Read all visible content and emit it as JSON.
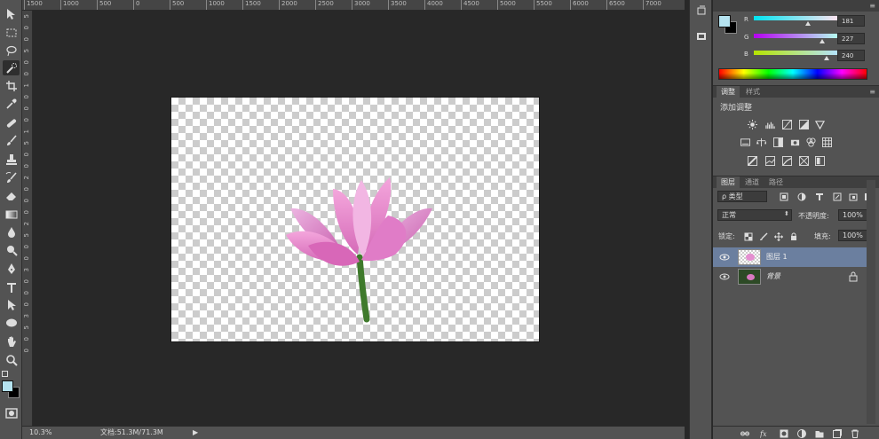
{
  "tools": [
    {
      "name": "move-tool-icon",
      "symbol": "move"
    },
    {
      "name": "rect-marquee-icon",
      "symbol": "marquee"
    },
    {
      "name": "lasso-icon",
      "symbol": "lasso"
    },
    {
      "name": "quick-select-icon",
      "symbol": "brushsel"
    },
    {
      "name": "crop-icon",
      "symbol": "crop"
    },
    {
      "name": "eyedropper-icon",
      "symbol": "eyedrop"
    },
    {
      "name": "healing-icon",
      "symbol": "heal"
    },
    {
      "name": "brush-icon",
      "symbol": "brush"
    },
    {
      "name": "clone-stamp-icon",
      "symbol": "stamp"
    },
    {
      "name": "history-brush-icon",
      "symbol": "hbrush"
    },
    {
      "name": "eraser-icon",
      "symbol": "eraser"
    },
    {
      "name": "gradient-icon",
      "symbol": "gradient"
    },
    {
      "name": "blur-icon",
      "symbol": "drop"
    },
    {
      "name": "dodge-icon",
      "symbol": "dodge"
    },
    {
      "name": "pen-icon",
      "symbol": "pen"
    },
    {
      "name": "type-icon",
      "symbol": "T"
    },
    {
      "name": "path-select-icon",
      "symbol": "arrow"
    },
    {
      "name": "ellipse-icon",
      "symbol": "ellipse"
    },
    {
      "name": "hand-icon",
      "symbol": "hand"
    },
    {
      "name": "zoom-icon",
      "symbol": "zoom"
    }
  ],
  "ruler": {
    "top": [
      "1500",
      "1000",
      "500",
      "0",
      "500",
      "1000",
      "1500",
      "2000",
      "2500",
      "3000",
      "3500",
      "4000",
      "4500",
      "5000",
      "5500",
      "6000",
      "6500",
      "7000"
    ],
    "left": [
      "5",
      "0",
      "0",
      "5",
      "0",
      "0",
      "1",
      "0",
      "0",
      "0",
      "1",
      "5",
      "0",
      "0",
      "2",
      "0",
      "0",
      "0",
      "2",
      "5",
      "0",
      "0",
      "3",
      "0",
      "0",
      "0",
      "3",
      "5",
      "0",
      "0"
    ]
  },
  "status": {
    "zoom": "10.3%",
    "docinfo": "文档:51.3M/71.3M"
  },
  "colors": {
    "foreground": "#b5e3f0",
    "background": "#000000",
    "r_label": "R",
    "g_label": "G",
    "b_label": "B",
    "r": "181",
    "g": "227",
    "b": "240"
  },
  "adjustments": {
    "tab_active": "调整",
    "tab_other": "样式",
    "title": "添加调整"
  },
  "layers_panel": {
    "tabs": [
      "图层",
      "通道",
      "路径"
    ],
    "filter_kind": "ρ 类型",
    "blend_mode": "正常",
    "opacity_label": "不透明度:",
    "opacity_value": "100%",
    "lock_label": "锁定:",
    "fill_label": "填充:",
    "fill_value": "100%",
    "layers": [
      {
        "name": "图层 1",
        "selected": true
      },
      {
        "name": "背景",
        "selected": false,
        "locked": true
      }
    ]
  },
  "bottom_icons": [
    "link-layers-icon",
    "fx-icon",
    "mask-icon",
    "adjustment-layer-icon",
    "group-folder-icon",
    "new-layer-icon",
    "trash-icon"
  ]
}
